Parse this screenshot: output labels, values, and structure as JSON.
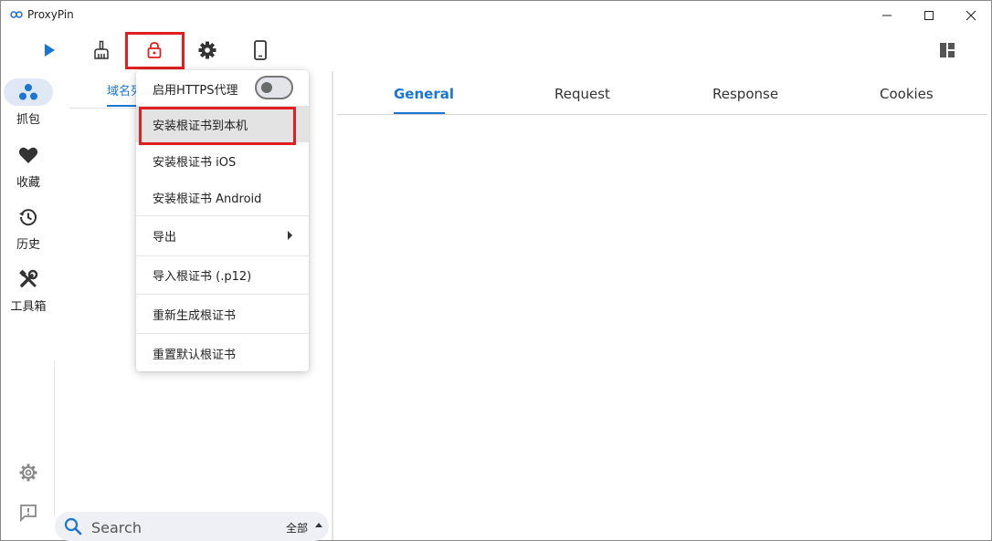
{
  "app": {
    "title": "ProxyPin"
  },
  "window_controls": {
    "minimize": "minimize",
    "maximize": "maximize",
    "close": "close"
  },
  "toolbar": [
    {
      "name": "start-capture",
      "icon": "play-icon"
    },
    {
      "name": "clear",
      "icon": "broom-icon"
    },
    {
      "name": "https-proxy",
      "icon": "lock-icon"
    },
    {
      "name": "settings",
      "icon": "gear-icon"
    },
    {
      "name": "mobile-connect",
      "icon": "phone-icon"
    },
    {
      "name": "layout",
      "icon": "layout-icon"
    }
  ],
  "nav": [
    {
      "label": "抓包",
      "icon": "capture-icon",
      "active": true
    },
    {
      "label": "收藏",
      "icon": "heart-icon",
      "active": false
    },
    {
      "label": "历史",
      "icon": "history-icon",
      "active": false
    },
    {
      "label": "工具箱",
      "icon": "tools-icon",
      "active": false
    }
  ],
  "nav_bottom": [
    {
      "icon": "gear-icon"
    },
    {
      "icon": "feedback-icon"
    }
  ],
  "middle": {
    "tab_visible_text": "域名列",
    "search_placeholder": "Search",
    "filter_label": "全部"
  },
  "detail_tabs": [
    "General",
    "Request",
    "Response",
    "Cookies"
  ],
  "https_menu": {
    "toggle_label": "启用HTTPS代理",
    "toggle_on": false,
    "items": [
      "安装根证书到本机",
      "安装根证书 iOS",
      "安装根证书 Android",
      "导出",
      "导入根证书 (.p12)",
      "重新生成根证书",
      "重置默认根证书"
    ]
  },
  "colors": {
    "accent": "#1976d2",
    "highlight": "#e02020",
    "play": "#1976d2"
  }
}
